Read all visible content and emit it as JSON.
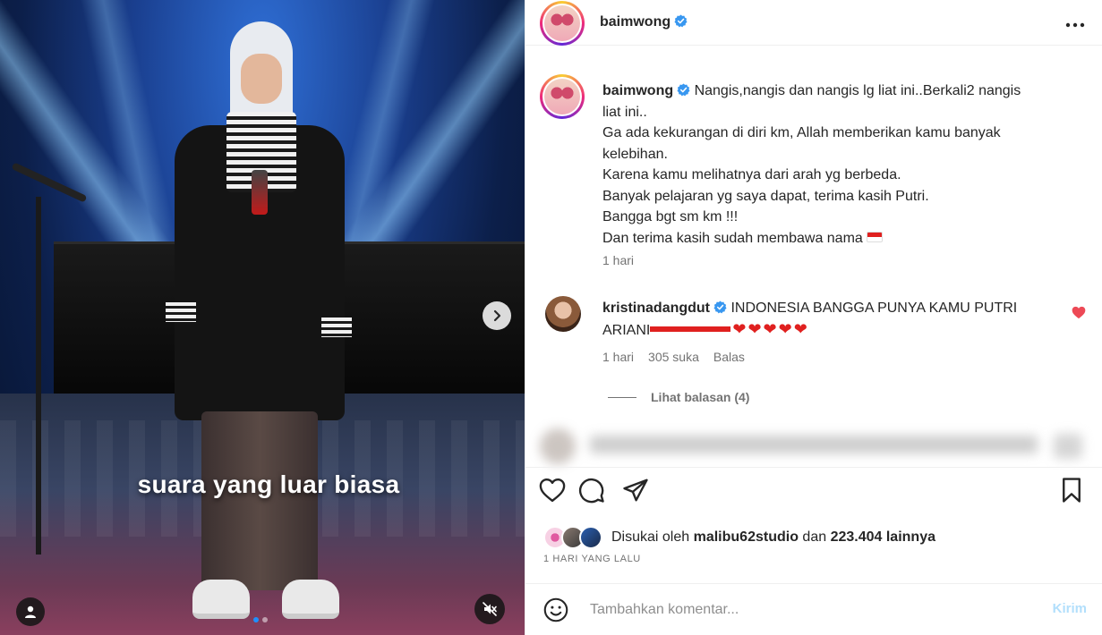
{
  "media": {
    "caption_overlay": "suara yang luar biasa",
    "carousel_dots": 2,
    "active_dot": 0
  },
  "header": {
    "username": "baimwong"
  },
  "caption": {
    "username": "baimwong",
    "lines": [
      "Nangis,nangis dan nangis lg liat ini..Berkali2 nangis",
      "liat ini..",
      "Ga ada kekurangan di diri km, Allah memberikan kamu banyak",
      "kelebihan.",
      "Karena kamu melihatnya dari arah yg berbeda.",
      "Banyak pelajaran yg saya dapat, terima kasih Putri.",
      "Bangga bgt sm km !!!",
      "Dan terima kasih sudah membawa nama"
    ],
    "time": "1 hari"
  },
  "comment": {
    "username": "kristinadangdut",
    "text_line1": "INDONESIA BANGGA PUNYA KAMU PUTRI",
    "text_line2": "ARIANI",
    "time": "1 hari",
    "likes": "305 suka",
    "reply": "Balas",
    "view_replies": "Lihat balasan (4)"
  },
  "likes": {
    "prefix": "Disukai oleh",
    "user": "malibu62studio",
    "middle": "dan",
    "count": "223.404 lainnya"
  },
  "post_date": "1 HARI YANG LALU",
  "comment_input": {
    "placeholder": "Tambahkan komentar...",
    "post_label": "Kirim"
  },
  "colors": {
    "verified": "#3897f0",
    "heart": "#ed4956",
    "post_disabled": "#b2dffc"
  }
}
